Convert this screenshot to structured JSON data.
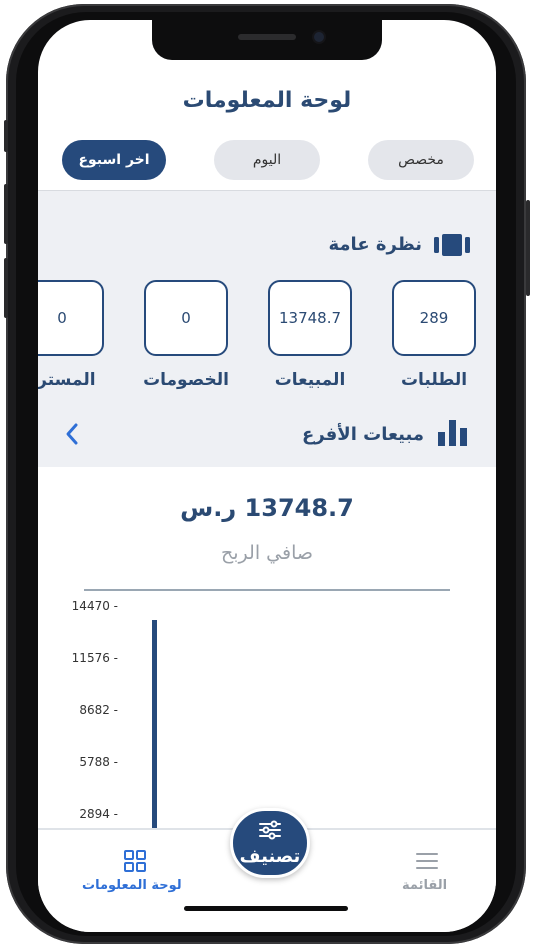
{
  "header": {
    "title": "لوحة المعلومات"
  },
  "filters": [
    {
      "label": "اخر اسبوع",
      "active": true
    },
    {
      "label": "اليوم",
      "active": false
    },
    {
      "label": "مخصص",
      "active": false
    }
  ],
  "overview": {
    "title": "نظرة عامة",
    "cards": [
      {
        "value": "289",
        "label": "الطلبات"
      },
      {
        "value": "13748.7",
        "label": "المبيعات"
      },
      {
        "value": "0",
        "label": "الخصومات"
      },
      {
        "value": "0",
        "label": "المسترد"
      }
    ]
  },
  "branches": {
    "title": "مبيعات الأفرع"
  },
  "summary": {
    "amount": "13748.7 ر.س",
    "label": "صافي الربح"
  },
  "chart_data": {
    "type": "bar",
    "yticks": [
      "14470",
      "11576",
      "8682",
      "5788",
      "2894"
    ],
    "ylim": [
      0,
      14470
    ],
    "values": [
      13748.7
    ]
  },
  "bottom_nav": {
    "dashboard": "لوحة المعلومات",
    "menu": "القائمة",
    "classify": "تصنيف"
  },
  "colors": {
    "primary": "#264a7c",
    "muted": "#9aa0a8",
    "chip": "#e4e6eb"
  }
}
